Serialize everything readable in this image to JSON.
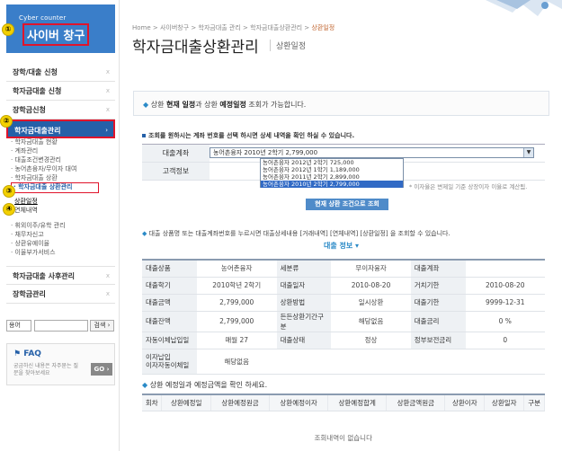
{
  "brand": {
    "subtitle": "Cyber counter",
    "title": "사이버 창구"
  },
  "markers": [
    "①",
    "②",
    "③",
    "④"
  ],
  "menu": {
    "top_items": [
      {
        "label": "장학/대출 신청",
        "x": "x"
      },
      {
        "label": "학자금대출 신청",
        "x": "x"
      },
      {
        "label": "장학금신청",
        "x": "x"
      },
      {
        "label": "학자금대출관리",
        "x": "›"
      }
    ],
    "sub_items": [
      "· 학자금대출 현황",
      "· 계좌관리",
      "· 대출조건변경관리",
      "· 농어촌융자/무이자 대여",
      "· 학자금대출 상환",
      "· 학자금대출 상환관리"
    ],
    "indent_items": [
      "상환일정",
      "연체내역"
    ],
    "more_items": [
      "· 휘외이주/유학 관리",
      "· 채무자신고",
      "· 상환유예이율",
      "· 이율부가서비스"
    ],
    "bottom_items": [
      {
        "label": "학자금대출 사후관리",
        "x": "x"
      },
      {
        "label": "장학금관리",
        "x": "x"
      }
    ]
  },
  "search": {
    "select": "용어",
    "button": "검색 ›"
  },
  "faq": {
    "title": "FAQ",
    "desc": "궁금하신 내용은 자주묻는 질문을 찾아보세요",
    "go": "GO ›"
  },
  "breadcrumb": {
    "path": "Home > 사이버창구 > 학자금대출 관리 > 학자금대출상환관리 > ",
    "current": "상환일정"
  },
  "page": {
    "title": "학자금대출상환관리",
    "subtitle": "상환일정"
  },
  "notice": {
    "pre": "상환 ",
    "b1": "현재 일정",
    "mid": "과 상환 ",
    "b2": "예정일정",
    "post": " 조회가 가능합니다."
  },
  "section1": {
    "text": "조회를 원하시는 계좌 번호를 선택 하시면 상세 내역을 확인 하실 수 있습니다."
  },
  "form": {
    "account_label": "대출계좌",
    "customer_label": "고객정보",
    "selected": "농어촌융자 2010년 2학기 2,799,000",
    "options": [
      "농어촌융자 2012년 2학기 725,000",
      "농어촌융자 2012년 1학기 1,189,000",
      "농어촌융자 2011년 2학기 2,899,000",
      "농어촌융자 2010년 2학기 2,799,000"
    ],
    "note": "* 이자율은 변제일 기준 상장이자 이율로 계산됨.",
    "button": "현재 상환 조건으로 조회"
  },
  "section2": {
    "pre": "대출 상품명 또는 대출계좌번호를 누르시면 대출상세내용 [거래내역] [연체내역] [상환일정] 을 조회할 수 있습니다.",
    "heading": "대출 정보 ▾"
  },
  "info_rows": [
    [
      "대출상품",
      "농어촌융자",
      "세분류",
      "무이자융자",
      "대출계좌",
      ""
    ],
    [
      "대출학기",
      "2010학년 2학기",
      "대출일자",
      "2010-08-20",
      "거치기한",
      "2010-08-20"
    ],
    [
      "대출금액",
      "2,799,000",
      "상환방법",
      "일시상환",
      "대출기한",
      "9999-12-31"
    ],
    [
      "대출잔액",
      "2,799,000",
      "든든상환기간구분",
      "해당없음",
      "대출금리",
      "0 %"
    ],
    [
      "자동이체납입일",
      "매월 27",
      "대출상태",
      "정상",
      "정부보전금리",
      "0"
    ]
  ],
  "info_last": {
    "h": "이자납입\n이자자동이체일",
    "v": "해당없음"
  },
  "section3": {
    "text": "상환 예정일과 예정금액을 확인 하세요."
  },
  "schedule": {
    "headers": [
      "회차",
      "상환예정일",
      "상환예정원금",
      "상환예정이자",
      "상환예정합계",
      "상환금액원금",
      "상환이자",
      "상환일자",
      "구분"
    ],
    "empty": "조회내역이 없습니다"
  }
}
